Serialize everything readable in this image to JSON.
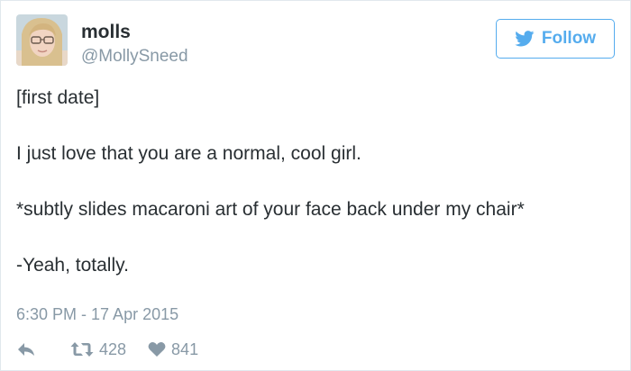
{
  "user": {
    "display_name": "molls",
    "screen_name": "@MollySneed"
  },
  "follow_button": {
    "label": "Follow",
    "icon": "twitter-bird-icon"
  },
  "tweet": {
    "lines": [
      "[first date]",
      "I just love that you are a normal, cool girl.",
      "*subtly slides macaroni art of your face back under my chair*",
      "-Yeah, totally."
    ],
    "timestamp": "6:30 PM - 17 Apr 2015"
  },
  "actions": {
    "reply_icon": "reply-icon",
    "retweet_icon": "retweet-icon",
    "retweet_count": "428",
    "like_icon": "heart-icon",
    "like_count": "841"
  },
  "colors": {
    "accent": "#55acee",
    "text": "#292f33",
    "muted": "#8899a6",
    "border": "#e1e8ed"
  }
}
